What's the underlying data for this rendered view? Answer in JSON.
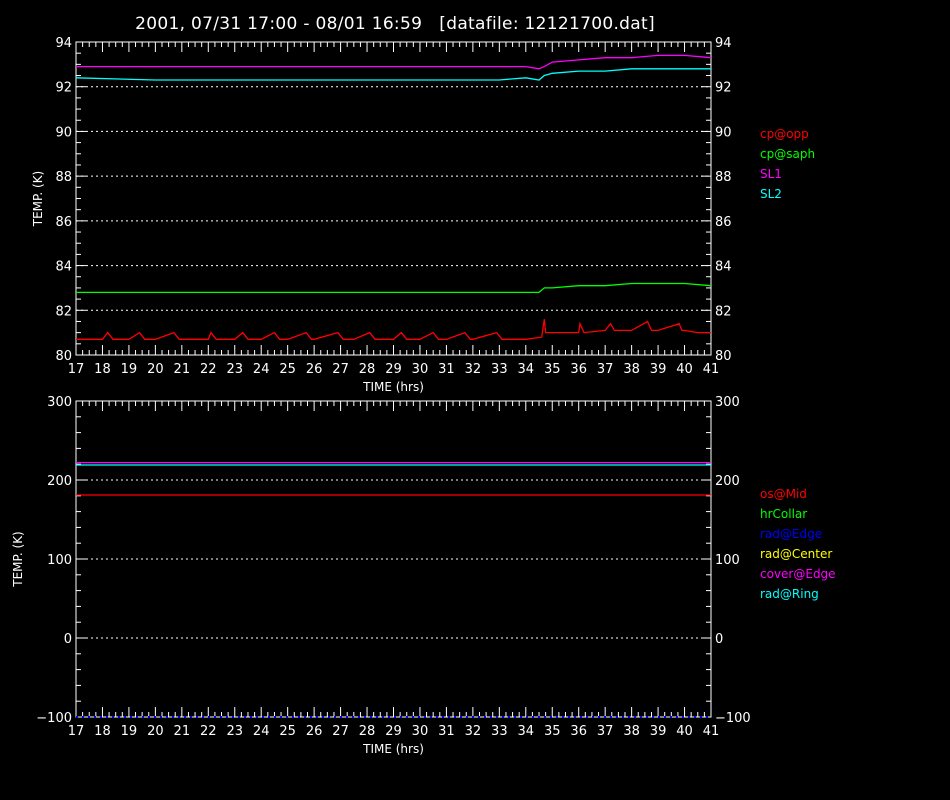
{
  "title": "2001, 07/31 17:00 - 08/01 16:59   [datafile: 12121700.dat]",
  "chart_data": [
    {
      "type": "line",
      "xlabel": "TIME (hrs)",
      "ylabel": "TEMP. (K)",
      "xlim": [
        17,
        41
      ],
      "ylim": [
        80,
        94
      ],
      "xticks": [
        17,
        18,
        19,
        20,
        21,
        22,
        23,
        24,
        25,
        26,
        27,
        28,
        29,
        30,
        31,
        32,
        33,
        34,
        35,
        36,
        37,
        38,
        39,
        40,
        41
      ],
      "yticks": [
        80,
        82,
        84,
        86,
        88,
        90,
        92,
        94
      ],
      "grid": true,
      "legend_position": "right",
      "series": [
        {
          "name": "cp@opp",
          "color": "#ff0000",
          "x": [
            17,
            18,
            18.2,
            18.4,
            19,
            19.4,
            19.6,
            20,
            20.7,
            20.9,
            21,
            22,
            22.1,
            22.3,
            23,
            23.3,
            23.5,
            24,
            24.5,
            24.7,
            25,
            25.7,
            25.9,
            26,
            26.9,
            27.1,
            27.5,
            28.1,
            28.3,
            29,
            29.3,
            29.5,
            30,
            30.5,
            30.7,
            31,
            31.7,
            31.9,
            32,
            32.9,
            33.1,
            33.5,
            34,
            34.6,
            34.7,
            34.75,
            34.85,
            35,
            35.5,
            36,
            36.05,
            36.2,
            37,
            37.2,
            37.35,
            37.5,
            38,
            38.6,
            38.75,
            39,
            39.8,
            39.9,
            40,
            40.5,
            41
          ],
          "y": [
            80.7,
            80.7,
            81.0,
            80.7,
            80.7,
            81.0,
            80.7,
            80.7,
            81.0,
            80.7,
            80.7,
            80.7,
            81.0,
            80.7,
            80.7,
            81.0,
            80.7,
            80.7,
            81.0,
            80.7,
            80.7,
            81.0,
            80.7,
            80.7,
            81.0,
            80.7,
            80.7,
            81.0,
            80.7,
            80.7,
            81.0,
            80.7,
            80.7,
            81.0,
            80.7,
            80.7,
            81.0,
            80.7,
            80.7,
            81.0,
            80.7,
            80.7,
            80.7,
            80.8,
            81.6,
            81.0,
            81.0,
            81.0,
            81.0,
            81.0,
            81.4,
            81.0,
            81.1,
            81.4,
            81.1,
            81.1,
            81.1,
            81.5,
            81.1,
            81.1,
            81.4,
            81.1,
            81.1,
            81.0,
            81.0
          ]
        },
        {
          "name": "cp@saph",
          "color": "#00ff00",
          "x": [
            17,
            20,
            25,
            30,
            33,
            34,
            34.5,
            34.7,
            35,
            36,
            37,
            38,
            39,
            40,
            41
          ],
          "y": [
            82.8,
            82.8,
            82.8,
            82.8,
            82.8,
            82.8,
            82.8,
            83.0,
            83.0,
            83.1,
            83.1,
            83.2,
            83.2,
            83.2,
            83.1
          ]
        },
        {
          "name": "SL1",
          "color": "#ff00ff",
          "x": [
            17,
            20,
            25,
            30,
            33,
            34,
            34.5,
            34.7,
            35,
            36,
            37,
            38,
            39,
            40,
            41
          ],
          "y": [
            92.9,
            92.9,
            92.9,
            92.9,
            92.9,
            92.9,
            92.8,
            92.9,
            93.1,
            93.2,
            93.3,
            93.3,
            93.4,
            93.4,
            93.3
          ]
        },
        {
          "name": "SL2",
          "color": "#00ffff",
          "x": [
            17,
            20,
            25,
            30,
            33,
            34,
            34.5,
            34.7,
            35,
            36,
            37,
            38,
            39,
            40,
            41
          ],
          "y": [
            92.4,
            92.3,
            92.3,
            92.3,
            92.3,
            92.4,
            92.3,
            92.5,
            92.6,
            92.7,
            92.7,
            92.8,
            92.8,
            92.8,
            92.8
          ]
        }
      ]
    },
    {
      "type": "line",
      "xlabel": "TIME (hrs)",
      "ylabel": "TEMP. (K)",
      "xlim": [
        17,
        41
      ],
      "ylim": [
        -100,
        300
      ],
      "xticks": [
        17,
        18,
        19,
        20,
        21,
        22,
        23,
        24,
        25,
        26,
        27,
        28,
        29,
        30,
        31,
        32,
        33,
        34,
        35,
        36,
        37,
        38,
        39,
        40,
        41
      ],
      "yticks": [
        -100,
        0,
        100,
        200,
        300
      ],
      "grid": true,
      "legend_position": "right",
      "series": [
        {
          "name": "os@Mid",
          "color": "#ff0000",
          "x": [
            17,
            41
          ],
          "y": [
            181,
            181
          ]
        },
        {
          "name": "hrCollar",
          "color": "#00ff00",
          "x": [],
          "y": []
        },
        {
          "name": "rad@Edge",
          "color": "#0000ff",
          "x": [
            17,
            41
          ],
          "y": [
            -100,
            -100
          ],
          "dotted": true
        },
        {
          "name": "rad@Center",
          "color": "#ffff00",
          "x": [],
          "y": []
        },
        {
          "name": "cover@Edge",
          "color": "#ff00ff",
          "x": [
            17,
            41
          ],
          "y": [
            222,
            222
          ]
        },
        {
          "name": "rad@Ring",
          "color": "#00ffff",
          "x": [
            17,
            41
          ],
          "y": [
            219,
            219
          ]
        }
      ]
    }
  ]
}
